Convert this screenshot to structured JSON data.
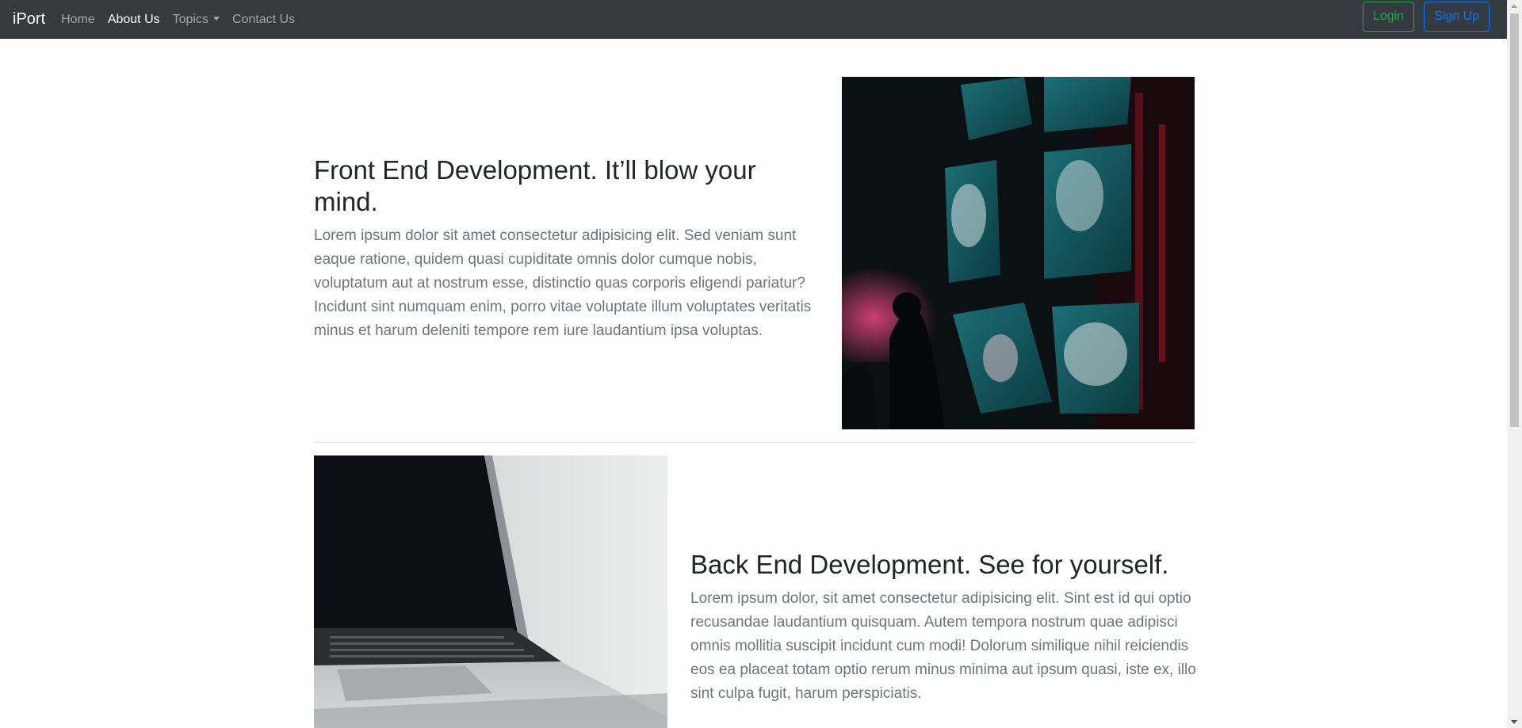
{
  "navbar": {
    "brand": "iPort",
    "links": [
      {
        "label": "Home"
      },
      {
        "label": "About Us"
      },
      {
        "label": "Topics"
      },
      {
        "label": "Contact Us"
      }
    ],
    "login_label": "Login",
    "signup_label": "Sign Up"
  },
  "features": [
    {
      "heading": "Front End Development. It’ll blow your mind.",
      "text": "Lorem ipsum dolor sit amet consectetur adipisicing elit. Sed veniam sunt eaque ratione, quidem quasi cupiditate omnis dolor cumque nobis, voluptatum aut at nostrum esse, distinctio quas corporis eligendi pariatur? Incidunt sint numquam enim, porro vitae voluptate illum voluptates veritatis minus et harum deleniti tempore rem iure laudantium ipsa voluptas."
    },
    {
      "heading": "Back End Development. See for yourself.",
      "text": "Lorem ipsum dolor, sit amet consectetur adipisicing elit. Sint est id qui optio recusandae laudantium quisquam. Autem tempora nostrum quae adipisci omnis mollitia suscipit incidunt cum modi! Dolorum similique nihil reiciendis eos ea placeat totam optio rerum minus minima aut ipsum quasi, iste ex, illo sint culpa fugit, harum perspiciatis."
    }
  ],
  "colors": {
    "navbar": "#343a40",
    "login": "#28a745",
    "signup": "#007bff",
    "muted_text": "#6c757d"
  }
}
